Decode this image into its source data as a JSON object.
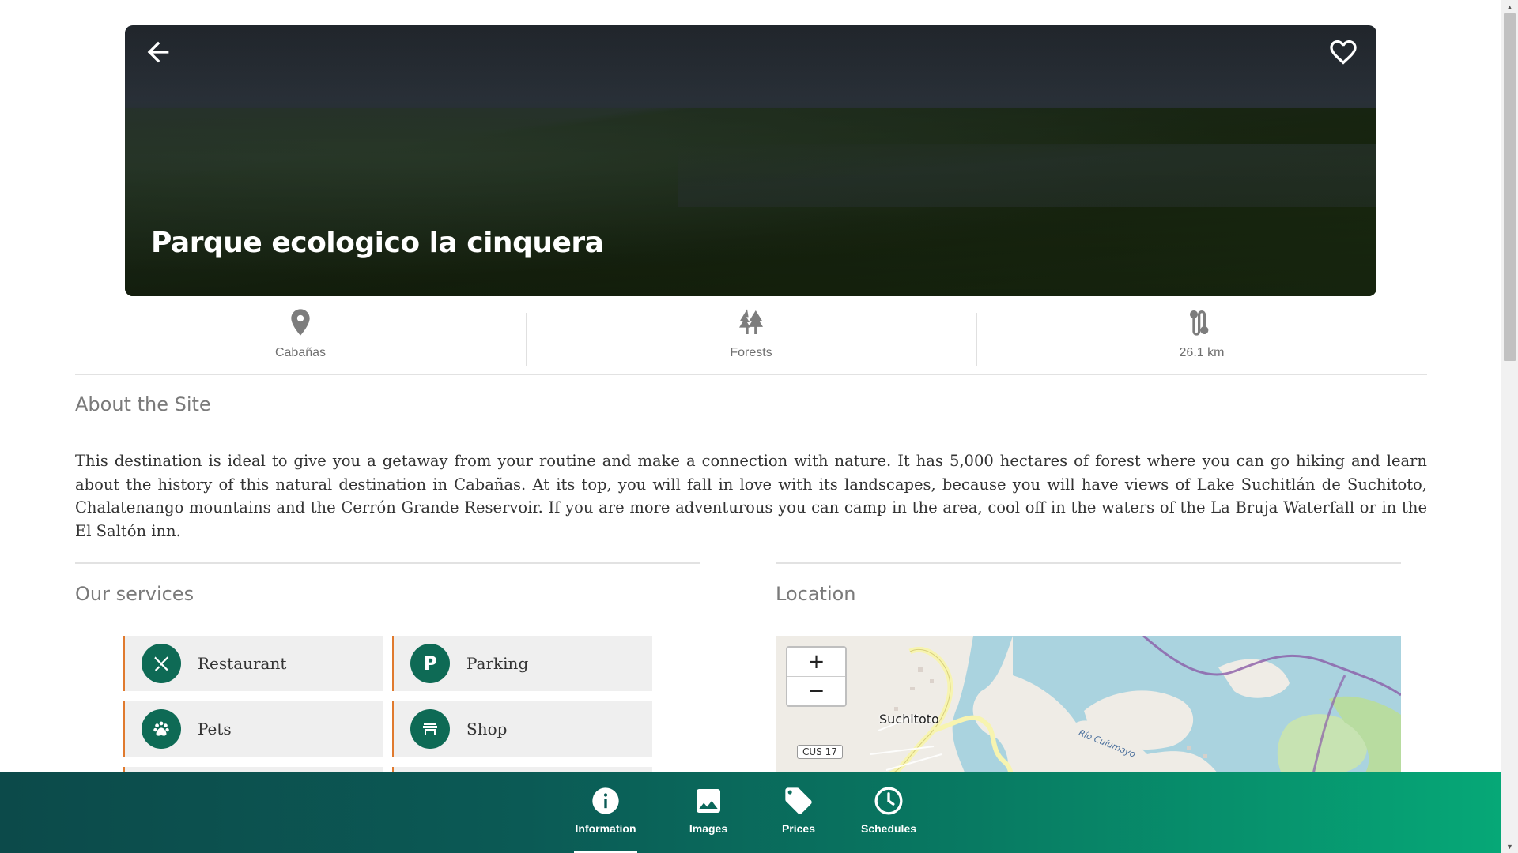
{
  "hero": {
    "title": "Parque ecologico la cinquera",
    "back_icon": "arrow-left-icon",
    "favorite_icon": "heart-outline-icon"
  },
  "info": {
    "items": [
      {
        "label": "Cabañas",
        "icon": "map-pin-icon"
      },
      {
        "label": "Forests",
        "icon": "trees-icon"
      },
      {
        "label": "26.1 km",
        "icon": "route-icon"
      }
    ]
  },
  "about": {
    "title": "About the Site",
    "text": "This destination is ideal to give you a getaway from your routine and make a connection with nature. It has 5,000 hectares of forest where you can go hiking and learn about the history of this natural destination in Cabañas. At its top, you will fall in love with its landscapes, because you will have views of Lake Suchitlán de Suchitoto, Chalatenango mountains and the Cerrón Grande Reservoir. If you are more adventurous you can camp in the area, cool off in the waters of the La Bruja Waterfall or in the El Saltón inn."
  },
  "services": {
    "title": "Our services",
    "items": [
      {
        "label": "Restaurant",
        "icon": "utensils-icon"
      },
      {
        "label": "Parking",
        "icon": "parking-icon",
        "glyph": "P"
      },
      {
        "label": "Pets",
        "icon": "paw-icon"
      },
      {
        "label": "Shop",
        "icon": "store-icon"
      }
    ]
  },
  "location": {
    "title": "Location",
    "zoom_in": "+",
    "zoom_out": "−",
    "town": "Suchitoto",
    "road": "CUS 17",
    "river": "Río Cuíumayo"
  },
  "nav": {
    "items": [
      {
        "label": "Information",
        "icon": "info-icon",
        "active": true
      },
      {
        "label": "Images",
        "icon": "image-icon",
        "active": false
      },
      {
        "label": "Prices",
        "icon": "tag-icon",
        "active": false
      },
      {
        "label": "Schedules",
        "icon": "clock-icon",
        "active": false
      }
    ]
  },
  "colors": {
    "accent_green": "#0e6a55",
    "service_border": "#e07a2e",
    "nav_gradient_start": "#0c4a4a",
    "nav_gradient_end": "#06a877"
  }
}
